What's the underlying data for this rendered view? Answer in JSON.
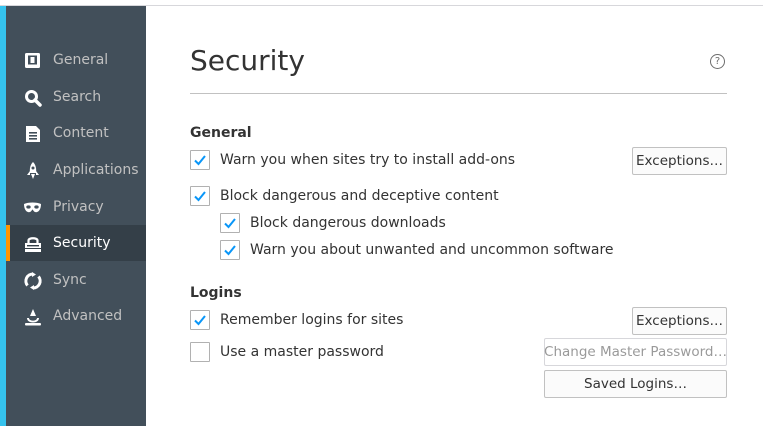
{
  "sidebar": {
    "items": [
      {
        "label": "General",
        "icon": "general-icon"
      },
      {
        "label": "Search",
        "icon": "search-icon"
      },
      {
        "label": "Content",
        "icon": "content-icon"
      },
      {
        "label": "Applications",
        "icon": "applications-icon"
      },
      {
        "label": "Privacy",
        "icon": "privacy-mask-icon"
      },
      {
        "label": "Security",
        "icon": "security-lock-icon",
        "active": true
      },
      {
        "label": "Sync",
        "icon": "sync-icon"
      },
      {
        "label": "Advanced",
        "icon": "advanced-icon"
      }
    ]
  },
  "page": {
    "title": "Security",
    "help_glyph": "?"
  },
  "general": {
    "heading": "General",
    "warn_addons": {
      "label": "Warn you when sites try to install add-ons",
      "checked": true
    },
    "exceptions_label": "Exceptions…",
    "block_dangerous": {
      "label": "Block dangerous and deceptive content",
      "checked": true
    },
    "block_downloads": {
      "label": "Block dangerous downloads",
      "checked": true
    },
    "warn_unwanted": {
      "label": "Warn you about unwanted and uncommon software",
      "checked": true
    }
  },
  "logins": {
    "heading": "Logins",
    "remember_logins": {
      "label": "Remember logins for sites",
      "checked": true
    },
    "exceptions_label": "Exceptions…",
    "master_password": {
      "label": "Use a master password",
      "checked": false
    },
    "change_master_label": "Change Master Password…",
    "saved_logins_label": "Saved Logins…"
  },
  "colors": {
    "sidebar_bg": "#424f5a",
    "sidebar_active_bg": "#343f48",
    "active_indicator": "#ff9500",
    "sidebar_edge": "#35c3ee",
    "check_color": "#0996f8"
  }
}
